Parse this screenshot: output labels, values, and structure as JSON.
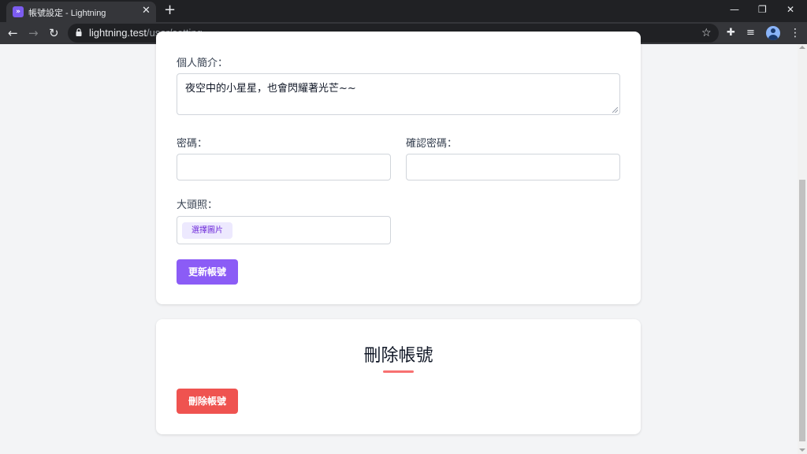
{
  "browser": {
    "tab_title": "帳號設定 - Lightning",
    "tab_close": "✕",
    "new_tab": "+",
    "url_host": "lightning.test",
    "url_path": "/user/setting",
    "window_minimize": "—",
    "window_restore": "❐",
    "window_close": "✕"
  },
  "form": {
    "bio_label": "個人簡介：",
    "bio_value": "夜空中的小星星，也會閃耀著光芒~~",
    "password_label": "密碼：",
    "password_value": "",
    "confirm_password_label": "確認密碼：",
    "confirm_password_value": "",
    "avatar_label": "大頭照：",
    "choose_image_label": "選擇圖片",
    "update_button": "更新帳號"
  },
  "delete_section": {
    "title": "刪除帳號",
    "delete_button": "刪除帳號"
  },
  "colors": {
    "primary": "#8b5cf6",
    "danger": "#ef5350",
    "accent_underline": "#f87171"
  }
}
